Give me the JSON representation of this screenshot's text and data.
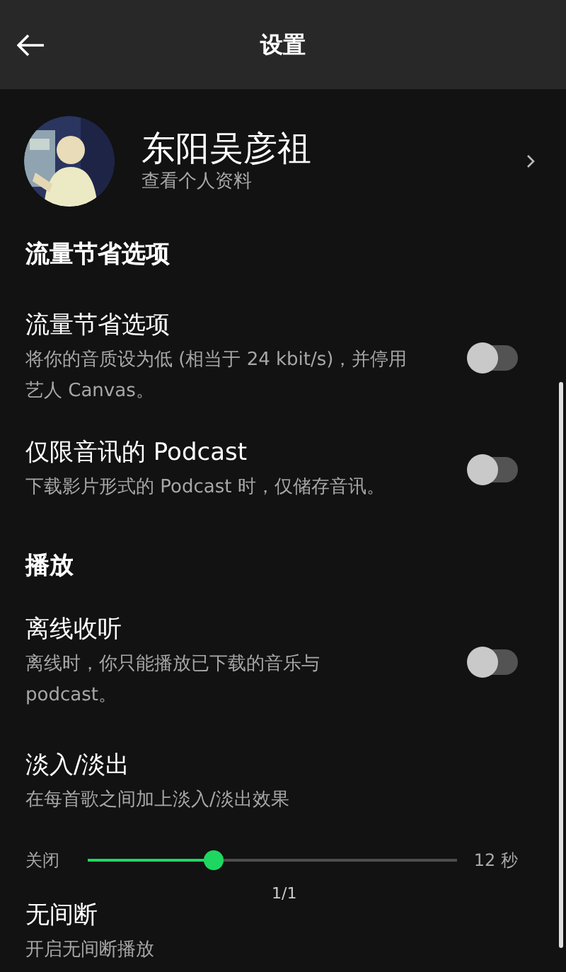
{
  "header": {
    "title": "设置"
  },
  "profile": {
    "name": "东阳吴彦祖",
    "subtitle": "查看个人资料"
  },
  "sections": [
    {
      "title": "流量节省选项",
      "items": [
        {
          "kind": "toggle",
          "title": "流量节省选项",
          "subtitle": "将你的音质设为低 (相当于 24 kbit/s)，并停用艺人 Canvas。",
          "on": false
        },
        {
          "kind": "toggle",
          "title": "仅限音讯的 Podcast",
          "subtitle": "下载影片形式的 Podcast 时，仅储存音讯。",
          "on": false
        }
      ]
    },
    {
      "title": "播放",
      "items": [
        {
          "kind": "toggle",
          "title": "离线收听",
          "subtitle": "离线时，你只能播放已下载的音乐与 podcast。",
          "on": false
        },
        {
          "kind": "slider",
          "title": "淡入/淡出",
          "subtitle": "在每首歌之间加上淡入/淡出效果",
          "min_label": "关闭",
          "max_label": "12 秒",
          "level": 0.34
        },
        {
          "kind": "plain",
          "title": "无间断",
          "subtitle": "开启无间断播放"
        }
      ]
    }
  ],
  "page_indicator": "1/1"
}
